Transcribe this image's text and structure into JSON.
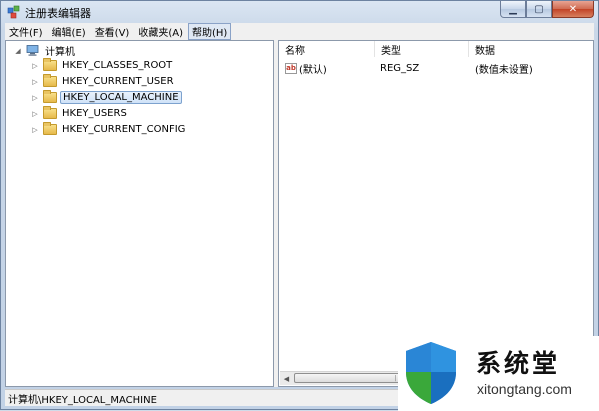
{
  "window": {
    "title": "注册表编辑器"
  },
  "menu": [
    {
      "label": "文件(F)"
    },
    {
      "label": "编辑(E)"
    },
    {
      "label": "查看(V)"
    },
    {
      "label": "收藏夹(A)"
    },
    {
      "label": "帮助(H)"
    }
  ],
  "tree": {
    "root": "计算机",
    "items": [
      {
        "label": "HKEY_CLASSES_ROOT"
      },
      {
        "label": "HKEY_CURRENT_USER"
      },
      {
        "label": "HKEY_LOCAL_MACHINE"
      },
      {
        "label": "HKEY_USERS"
      },
      {
        "label": "HKEY_CURRENT_CONFIG"
      }
    ]
  },
  "list": {
    "columns": [
      "名称",
      "类型",
      "数据"
    ],
    "rows": [
      {
        "name": "(默认)",
        "type": "REG_SZ",
        "data": "(数值未设置)"
      }
    ]
  },
  "status": {
    "path": "计算机\\HKEY_LOCAL_MACHINE"
  },
  "watermark": {
    "name": "系统堂",
    "url": "xitongtang.com"
  },
  "icons": {
    "app": "registry-icon",
    "root": "computer-icon",
    "folder": "folder-icon",
    "value": "string-value-icon"
  },
  "colors": {
    "selection": "#cfe2f8",
    "shield_blue": "#1f7fd1",
    "shield_green": "#3aa83a"
  }
}
